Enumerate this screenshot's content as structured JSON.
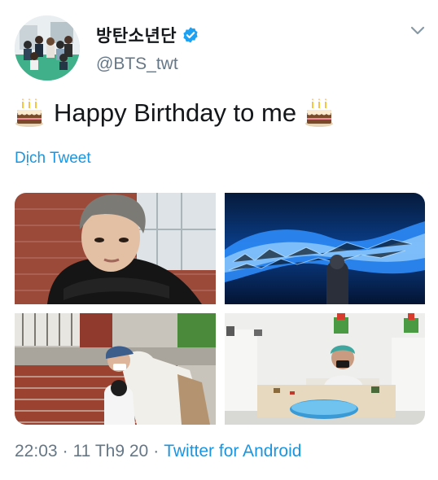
{
  "tweet": {
    "author": {
      "display_name": "방탄소년단",
      "handle": "@BTS_twt",
      "verified": true,
      "avatar_icon": "group-photo-avatar"
    },
    "text": "Happy Birthday to me",
    "emoji": "birthday-cake",
    "translate_label": "Dịch Tweet",
    "media": [
      {
        "name": "photo-portrait"
      },
      {
        "name": "photo-blue-installation"
      },
      {
        "name": "photo-brick-wall"
      },
      {
        "name": "photo-pool-room"
      }
    ],
    "meta": {
      "time": "22:03",
      "separator": "·",
      "date": "11 Th9 20",
      "source": "Twitter for Android"
    }
  },
  "colors": {
    "link": "#1b95e0",
    "secondary_text": "#657786",
    "primary_text": "#14171a",
    "verified_badge": "#1da1f2"
  }
}
